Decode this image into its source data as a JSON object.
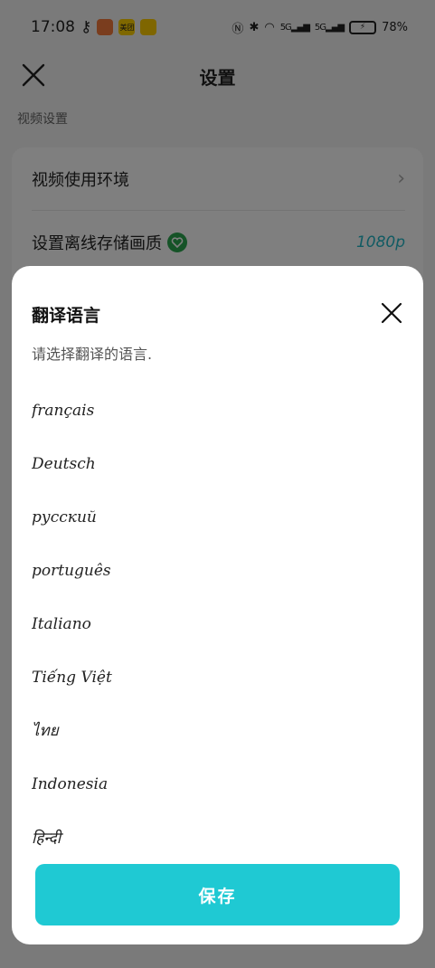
{
  "status_bar": {
    "time": "17:08",
    "battery": "78%",
    "network_1": "5G",
    "network_2": "5G",
    "app_badge_2_text": "美团"
  },
  "header": {
    "title": "设置"
  },
  "settings": {
    "section_label": "视频设置",
    "rows": [
      {
        "label": "视频使用环境",
        "value": ""
      },
      {
        "label": "设置离线存储画质",
        "value": "1080p"
      }
    ]
  },
  "dialog": {
    "title": "翻译语言",
    "subtitle": "请选择翻译的语言.",
    "languages": [
      "français",
      "Deutsch",
      "русский",
      "português",
      "Italiano",
      "Tiếng Việt",
      "ไทย",
      "Indonesia",
      "हिन्दी"
    ],
    "save_label": "保存"
  },
  "colors": {
    "accent": "#1fc9d3",
    "value_text": "#22b6c6",
    "badge_green": "#2aa64e"
  }
}
